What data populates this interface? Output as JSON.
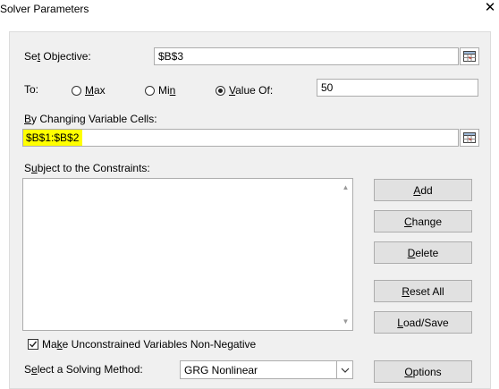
{
  "window": {
    "title": "Solver Parameters",
    "close_glyph": "✕"
  },
  "objective": {
    "label_prefix": "Se",
    "label_hot": "t",
    "label_suffix": " Objective:",
    "value": "$B$3",
    "picker_icon": "range-selector-icon"
  },
  "to": {
    "label": "To:",
    "options": [
      {
        "hot": "M",
        "rest": "ax",
        "selected": false
      },
      {
        "pre": "Mi",
        "hot": "n",
        "selected": false
      },
      {
        "hot": "V",
        "rest": "alue Of:",
        "selected": true
      }
    ],
    "value_of": "50"
  },
  "changing": {
    "label_hot": "B",
    "label_rest": "y Changing Variable Cells:",
    "value": "$B$1:$B$2",
    "highlight_color": "#ffff00",
    "picker_icon": "range-selector-icon"
  },
  "constraints": {
    "label_hot": "u",
    "label_pre": "S",
    "label_rest": "bject to the Constraints:",
    "items": []
  },
  "buttons": {
    "add": {
      "hot": "A",
      "rest": "dd"
    },
    "change": {
      "hot": "C",
      "rest": "hange"
    },
    "delete": {
      "hot": "D",
      "rest": "elete"
    },
    "reset_all": {
      "hot": "R",
      "rest": "eset All"
    },
    "load_save": {
      "hot": "L",
      "rest": "oad/Save"
    },
    "options": {
      "hot": "O",
      "rest": "ptions"
    }
  },
  "nonneg": {
    "checked": true,
    "label_pre": "Ma",
    "label_hot": "k",
    "label_rest": "e Unconstrained Variables Non-Negative"
  },
  "method": {
    "label_pre": "S",
    "label_hot": "e",
    "label_rest": "lect a Solving Method:",
    "selected": "GRG Nonlinear"
  }
}
